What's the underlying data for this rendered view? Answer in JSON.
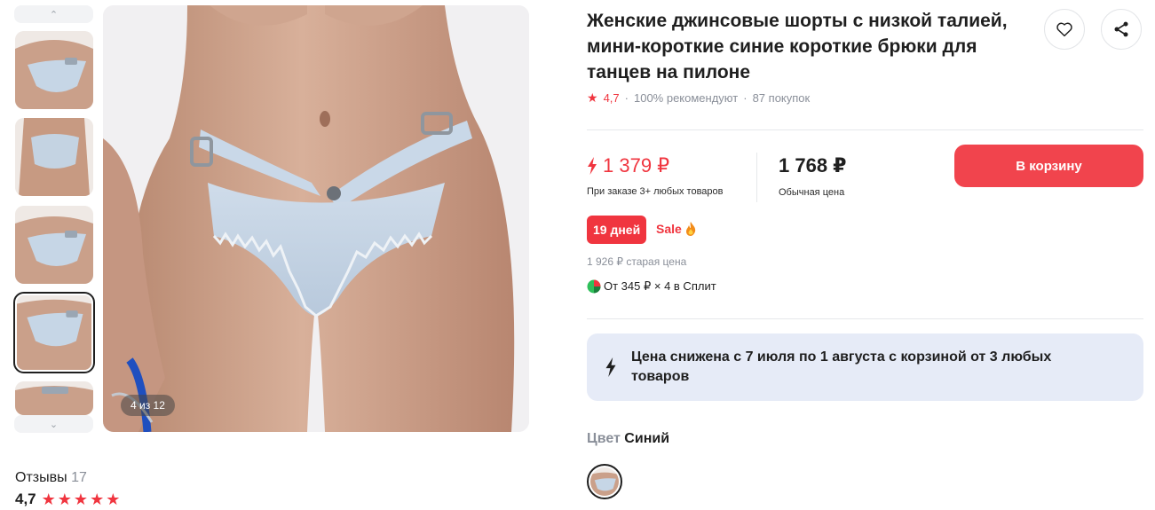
{
  "product": {
    "title": "Женские джинсовые шорты с низкой талией, мини-короткие синие короткие брюки для танцев на пилоне",
    "rating": "4,7",
    "recommend": "100% рекомендуют",
    "purchases": "87 покупок"
  },
  "gallery": {
    "counter": "4 из 12",
    "active_index": 4
  },
  "reviews": {
    "label": "Отзывы",
    "count": "17",
    "rating": "4,7",
    "stars": 4.7
  },
  "pricing": {
    "special_price": "1 379 ₽",
    "special_note": "При заказе 3+ любых товаров",
    "regular_price": "1 768 ₽",
    "regular_note": "Обычная цена",
    "cart_label": "В корзину",
    "days_badge": "19 дней",
    "sale_label": "Sale",
    "old_price": "1 926 ₽ старая цена",
    "split": "От 345 ₽ × 4 в Сплит"
  },
  "promo": {
    "text": "Цена снижена с 7 июля по 1 августа с корзиной от 3 любых товаров"
  },
  "color": {
    "label": "Цвет",
    "value": "Синий"
  },
  "colors": {
    "accent": "#f0353f",
    "promo_bg": "#e6ebf7"
  }
}
